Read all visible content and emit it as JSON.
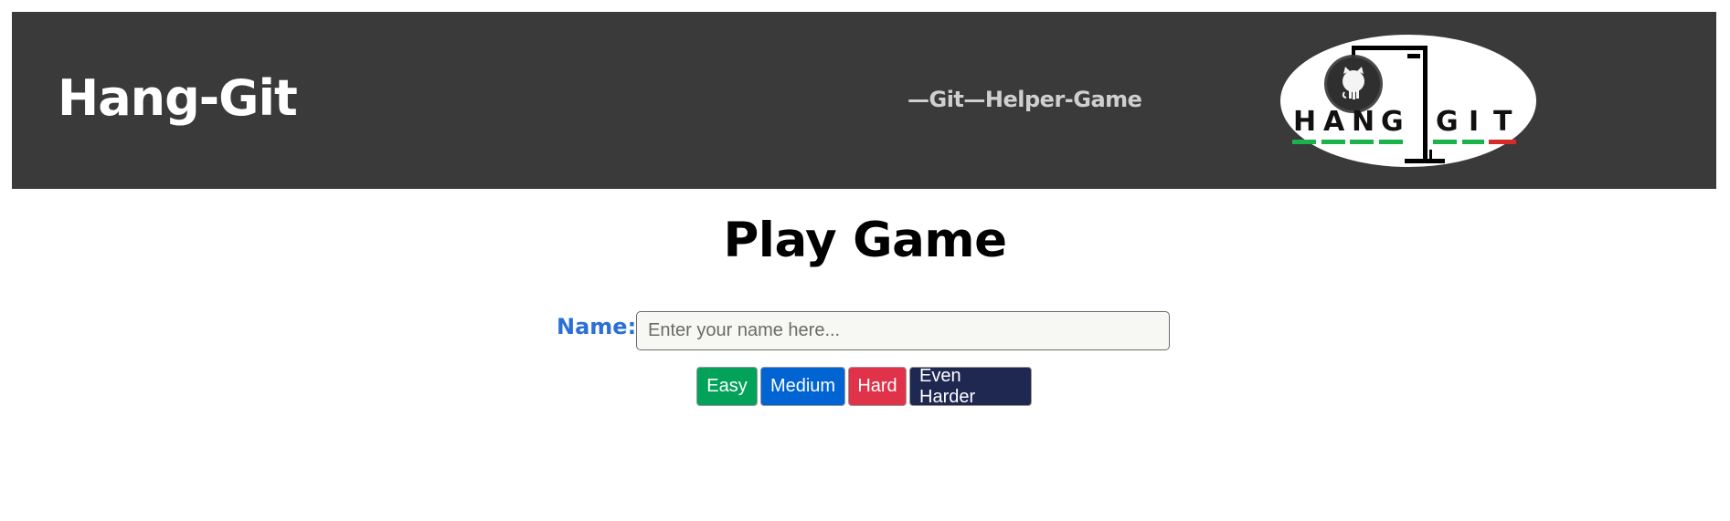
{
  "header": {
    "brand": "Hang-Git",
    "tagline": "—Git—Helper-Game",
    "logo": {
      "word1": "HANG",
      "word2": "GIT",
      "icon": "github-octocat-icon"
    }
  },
  "main": {
    "title": "Play Game",
    "name_label": "Name:",
    "name_placeholder": "Enter your name here...",
    "name_value": "",
    "buttons": {
      "easy": "Easy",
      "medium": "Medium",
      "hard": "Hard",
      "even_harder": "Even Harder"
    }
  },
  "colors": {
    "header_bg": "#3a3a3a",
    "label_blue": "#2b6fd6",
    "easy": "#03a25a",
    "medium": "#0064d2",
    "hard": "#e0334a",
    "even_harder": "#1f2851",
    "logo_green_underline": "#19b34a",
    "logo_red_underline": "#d92a2a"
  }
}
